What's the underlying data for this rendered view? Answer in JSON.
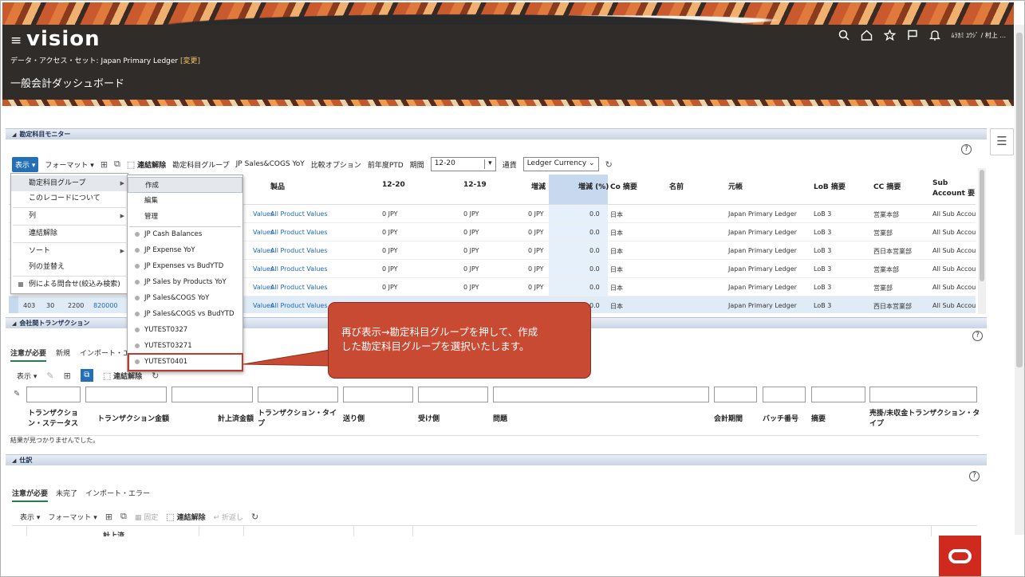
{
  "header": {
    "logo": "vision",
    "data_access_label": "データ・アクセス・セット: Japan Primary Ledger",
    "change_link": "[変更]",
    "page_title": "一般会計ダッシュボード",
    "user_name": "ﾑﾗｶﾐ ﾕｳｼﾞ / 村上 ..."
  },
  "panel1": {
    "title": "勘定科目モニター",
    "toolbar": {
      "display": "表示",
      "format": "フォーマット",
      "detach": "連結解除",
      "account_group_label": "勘定科目グループ",
      "account_group_value": "JP Sales&COGS YoY",
      "compare_label": "比較オプション",
      "compare_value": "前年度PTD",
      "period_label": "期間",
      "period_value": "12-20",
      "currency_label": "通貨",
      "currency_value": "Ledger Currency"
    },
    "columns": [
      "製品",
      "12-20",
      "12-19",
      "増減",
      "増減 (%)",
      "Co 摘要",
      "名前",
      "元帳",
      "LoB 摘要",
      "CC 摘要",
      "Sub Account 要"
    ],
    "rows": [
      {
        "lead": "Values",
        "product": "All Product Values",
        "c1": "0 JPY",
        "c2": "0 JPY",
        "c3": "0 JPY",
        "pct": "0.0",
        "co": "日本",
        "ledger": "Japan Primary Ledger",
        "lob": "LoB 3",
        "cc": "営業本部",
        "sub": "All Sub Accoun"
      },
      {
        "lead": "Values",
        "product": "All Product Values",
        "c1": "0 JPY",
        "c2": "0 JPY",
        "c3": "0 JPY",
        "pct": "0.0",
        "co": "日本",
        "ledger": "Japan Primary Ledger",
        "lob": "LoB 3",
        "cc": "営業部",
        "sub": "All Sub Accoun"
      },
      {
        "lead": "Values",
        "product": "All Product Values",
        "c1": "0 JPY",
        "c2": "0 JPY",
        "c3": "0 JPY",
        "pct": "0.0",
        "co": "日本",
        "ledger": "Japan Primary Ledger",
        "lob": "LoB 3",
        "cc": "西日本営業部",
        "sub": "All Sub Accoun"
      },
      {
        "lead": "Values",
        "product": "All Product Values",
        "c1": "0 JPY",
        "c2": "0 JPY",
        "c3": "0 JPY",
        "pct": "0.0",
        "co": "日本",
        "ledger": "Japan Primary Ledger",
        "lob": "LoB 3",
        "cc": "営業本部",
        "sub": "All Sub Accoun"
      },
      {
        "lead": "Values",
        "product": "All Product Values",
        "c1": "0 JPY",
        "c2": "0 JPY",
        "c3": "0 JPY",
        "pct": "0.0",
        "co": "日本",
        "ledger": "Japan Primary Ledger",
        "lob": "LoB 3",
        "cc": "営業部",
        "sub": "All Sub Accoun"
      },
      {
        "lead": "Values",
        "product": "All Product Values",
        "c1": "",
        "c2": "",
        "c3": "",
        "pct": "0.0",
        "co": "日本",
        "ledger": "Japan Primary Ledger",
        "lob": "LoB 3",
        "cc": "西日本営業部",
        "sub": "All Sub Accoun"
      }
    ],
    "selected_row_prefix": [
      "403",
      "30",
      "2200",
      "820000"
    ]
  },
  "menu_display": {
    "items": [
      "勘定科目グループ",
      "このレコードについて",
      "列",
      "連結解除",
      "ソート",
      "列の並替え",
      "例による問合せ(絞込み検索)"
    ]
  },
  "menu_account_group": {
    "actions": [
      "作成",
      "編集",
      "管理"
    ],
    "groups": [
      "JP Cash Balances",
      "JP Expense YoY",
      "JP Expenses vs BudYTD",
      "JP Sales by Products YoY",
      "JP Sales&COGS YoY",
      "JP Sales&COGS vs BudYTD",
      "YUTEST0327",
      "YUTEST03271",
      "YUTEST0401"
    ]
  },
  "callout": {
    "text_line1": "再び表示→勘定科目グループを押して、作成",
    "text_line2": "した勘定科目グループを選択いたします。"
  },
  "panel2": {
    "title": "会社間トランザクション",
    "tabs": [
      "注意が必要",
      "新規",
      "インポート・エラー"
    ],
    "toolbar": {
      "display": "表示",
      "detach": "連結解除"
    },
    "columns": [
      "トランザクショ ン・ステータス",
      "トランザクション金額",
      "計上済金額",
      "トランザクション・タイ プ",
      "送り側",
      "受け側",
      "問題",
      "会計期間",
      "バッチ番号",
      "摘要",
      "売掛/未収金トランザクション・タ イプ"
    ],
    "empty_message": "結果が見つかりませんでした。"
  },
  "panel3": {
    "title": "仕訳",
    "tabs": [
      "注意が必要",
      "未完了",
      "インポート・エラー"
    ],
    "toolbar": {
      "display": "表示",
      "format": "フォーマット",
      "freeze": "固定",
      "detach": "連結解除",
      "wrap": "折返し"
    },
    "first_column": "計上済"
  },
  "colors": {
    "header_bg": "#2f2c2a",
    "accent_blue": "#2470b8",
    "callout_bg": "#c94a33",
    "highlight_box": "#c0392b",
    "oracle_red": "#d02a1e"
  }
}
